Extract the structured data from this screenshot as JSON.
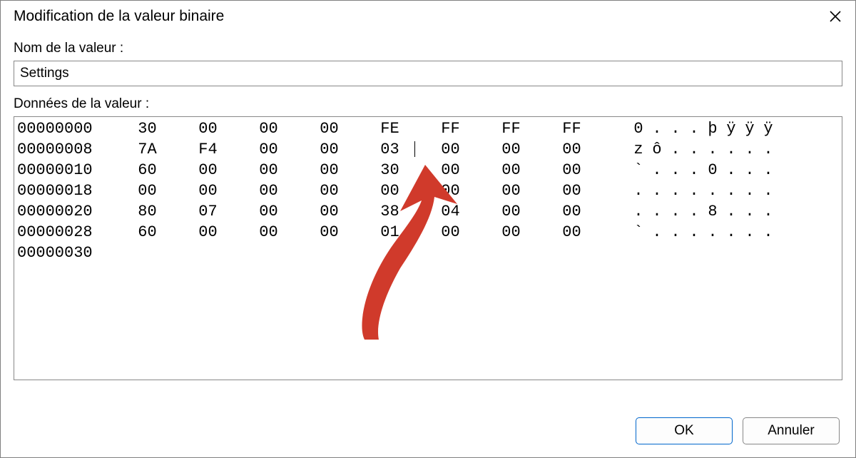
{
  "dialog": {
    "title": "Modification de la valeur binaire",
    "close_tooltip": "Fermer"
  },
  "labels": {
    "value_name": "Nom de la valeur :",
    "value_data": "Données de la valeur :"
  },
  "fields": {
    "value_name": "Settings"
  },
  "buttons": {
    "ok": "OK",
    "cancel": "Annuler"
  },
  "hex": {
    "rows": [
      {
        "offset": "00000000",
        "bytes": [
          "30",
          "00",
          "00",
          "00",
          "FE",
          "FF",
          "FF",
          "FF"
        ],
        "ascii": [
          "0",
          ".",
          ".",
          ".",
          "þ",
          "ÿ",
          "ÿ",
          "ÿ"
        ]
      },
      {
        "offset": "00000008",
        "bytes": [
          "7A",
          "F4",
          "00",
          "00",
          "03",
          "00",
          "00",
          "00"
        ],
        "ascii": [
          "z",
          "ô",
          ".",
          ".",
          ".",
          ".",
          ".",
          "."
        ]
      },
      {
        "offset": "00000010",
        "bytes": [
          "60",
          "00",
          "00",
          "00",
          "30",
          "00",
          "00",
          "00"
        ],
        "ascii": [
          "`",
          ".",
          ".",
          ".",
          "0",
          ".",
          ".",
          "."
        ]
      },
      {
        "offset": "00000018",
        "bytes": [
          "00",
          "00",
          "00",
          "00",
          "00",
          "00",
          "00",
          "00"
        ],
        "ascii": [
          ".",
          ".",
          ".",
          ".",
          ".",
          ".",
          ".",
          "."
        ]
      },
      {
        "offset": "00000020",
        "bytes": [
          "80",
          "07",
          "00",
          "00",
          "38",
          "04",
          "00",
          "00"
        ],
        "ascii": [
          ".",
          ".",
          ".",
          ".",
          "8",
          ".",
          ".",
          "."
        ]
      },
      {
        "offset": "00000028",
        "bytes": [
          "60",
          "00",
          "00",
          "00",
          "01",
          "00",
          "00",
          "00"
        ],
        "ascii": [
          "`",
          ".",
          ".",
          ".",
          ".",
          ".",
          ".",
          "."
        ]
      },
      {
        "offset": "00000030",
        "bytes": [],
        "ascii": []
      }
    ]
  },
  "annotation": {
    "arrow_color": "#d03a2b"
  }
}
